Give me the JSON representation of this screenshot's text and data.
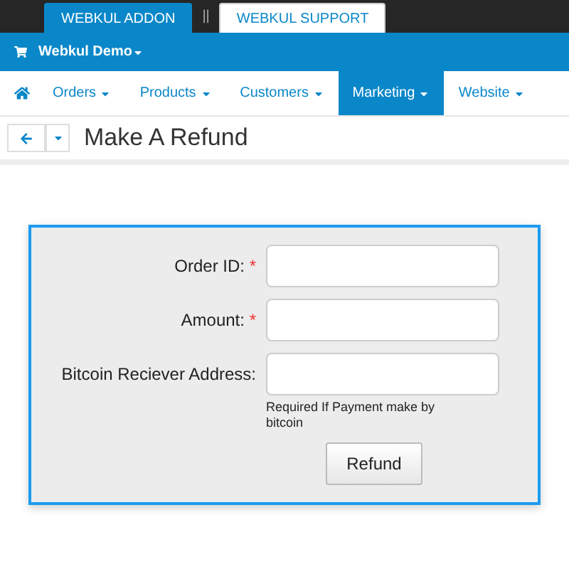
{
  "top_tabs": [
    {
      "label": "WEBKUL ADDON",
      "selected": true
    },
    {
      "label": "WEBKUL SUPPORT",
      "selected": false
    }
  ],
  "top_separator": "||",
  "shop": {
    "label": "Webkul Demo"
  },
  "nav": [
    {
      "label": "Orders",
      "selected": false
    },
    {
      "label": "Products",
      "selected": false
    },
    {
      "label": "Customers",
      "selected": false
    },
    {
      "label": "Marketing",
      "selected": true
    },
    {
      "label": "Website",
      "selected": false
    }
  ],
  "page_title": "Make A Refund",
  "form": {
    "fields": [
      {
        "label": "Order ID:",
        "required": true
      },
      {
        "label": "Amount:",
        "required": true
      },
      {
        "label": "Bitcoin Reciever Address:",
        "required": false,
        "hint": "Required If Payment make by bitcoin"
      }
    ],
    "required_mark": "*",
    "submit": "Refund"
  }
}
